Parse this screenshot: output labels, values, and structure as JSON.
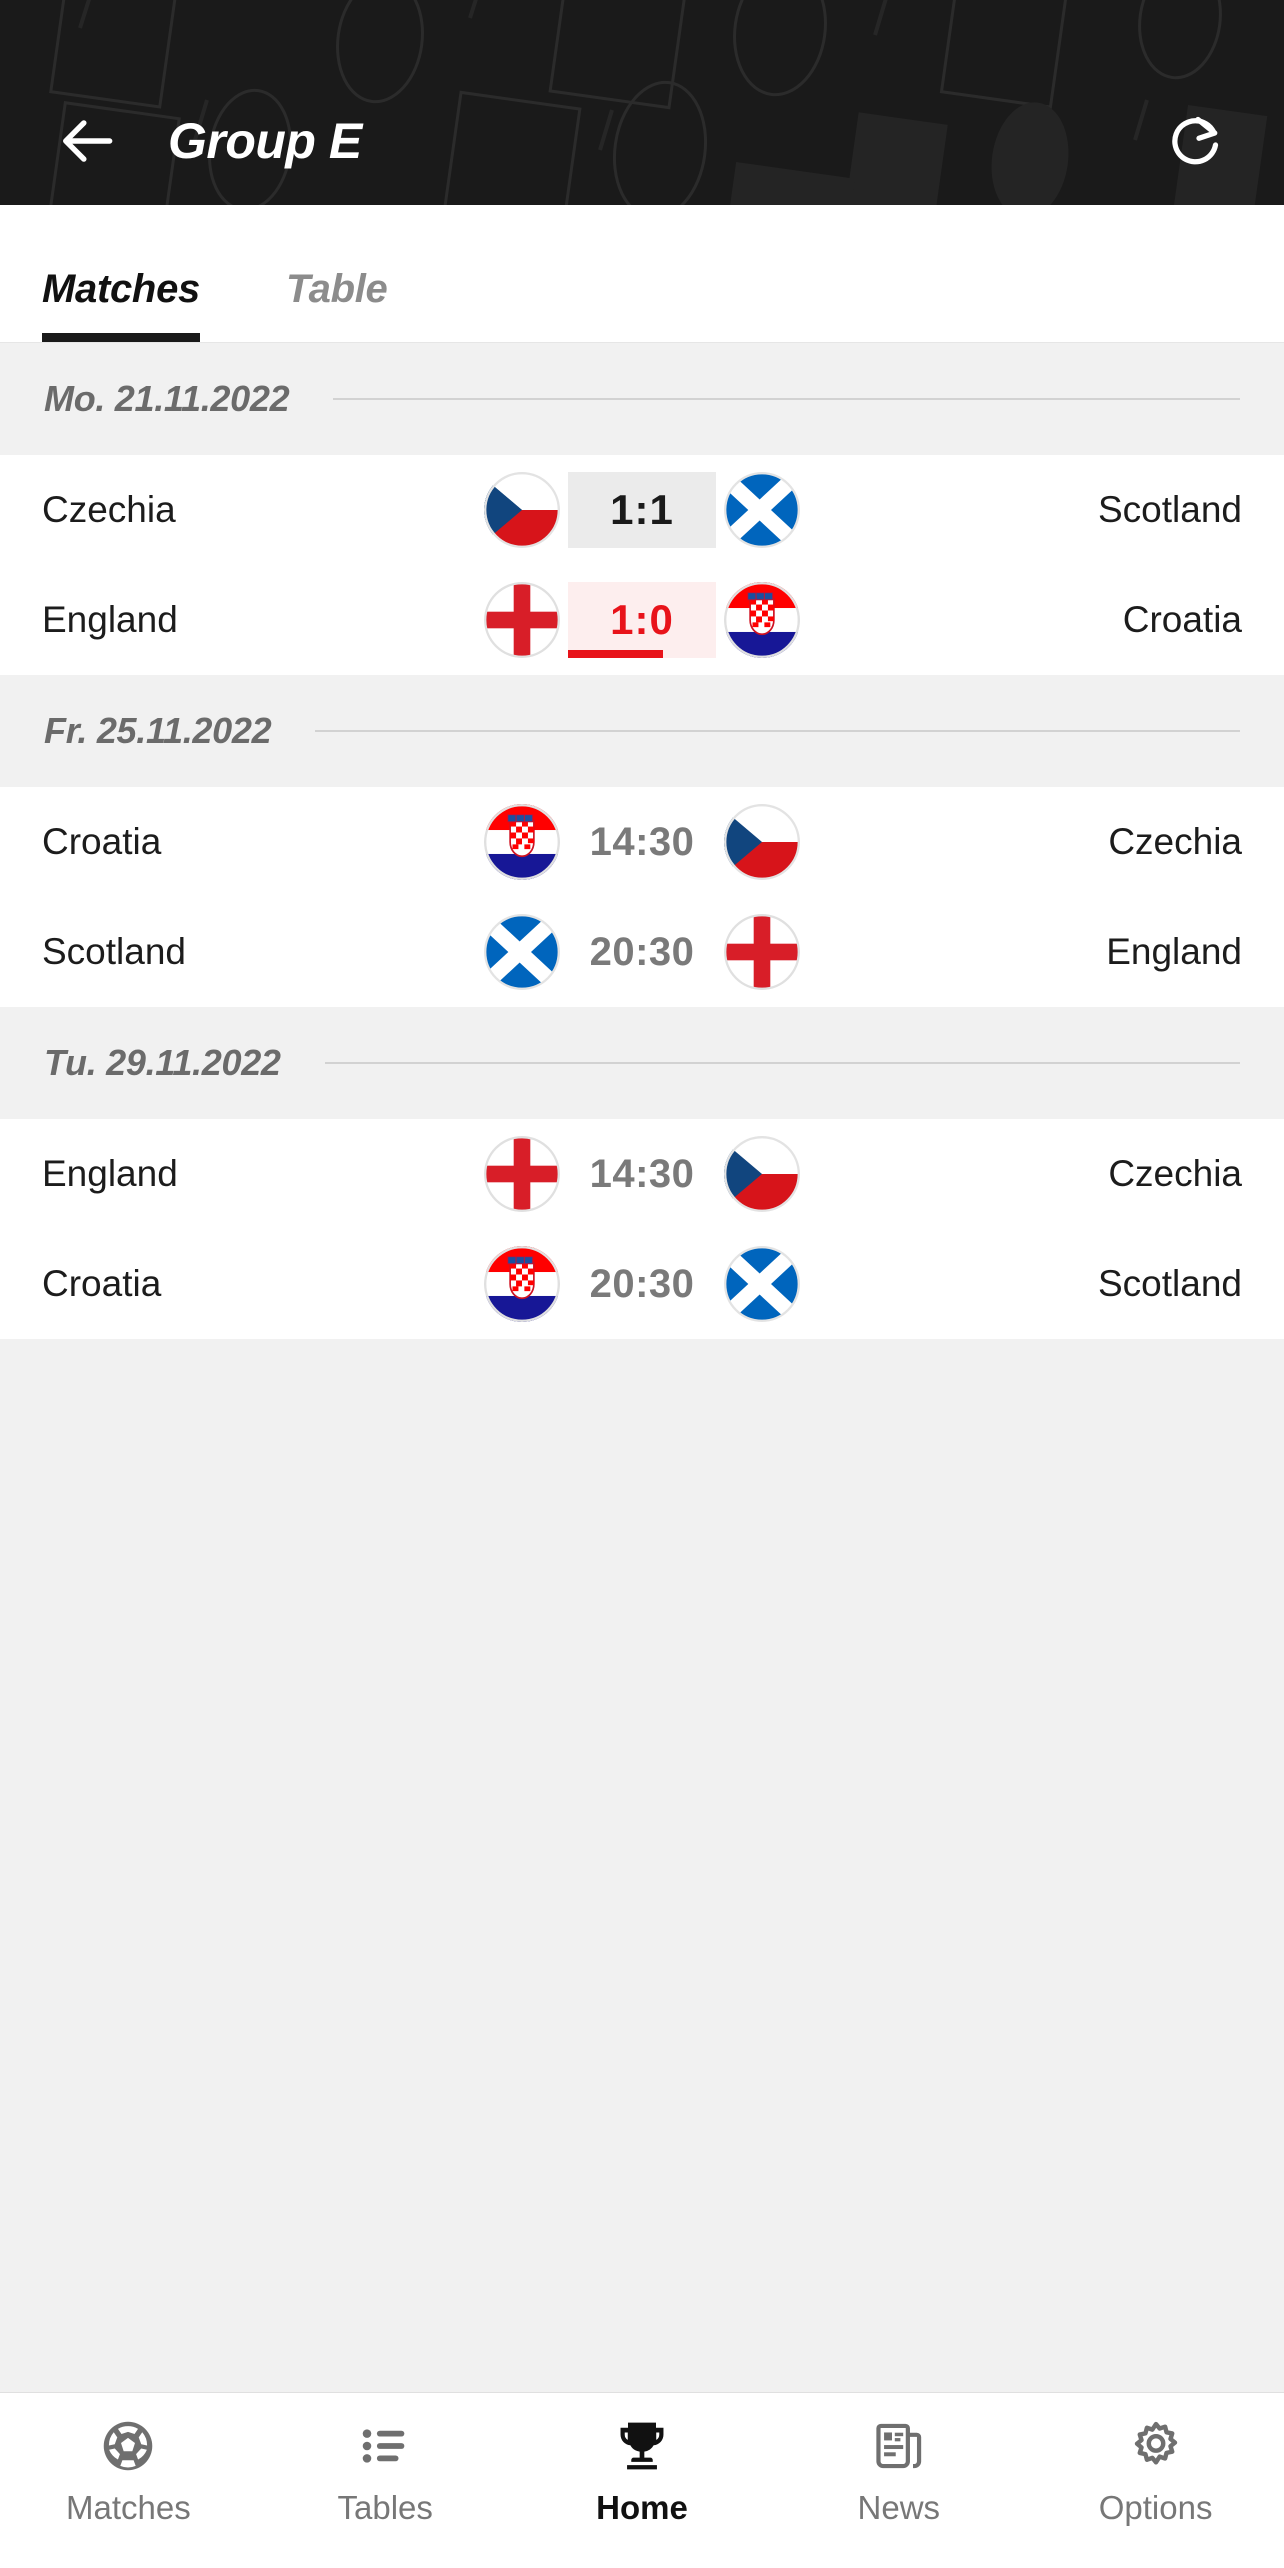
{
  "header": {
    "title": "Group E",
    "back_icon": "arrow-left-icon",
    "refresh_icon": "refresh-icon"
  },
  "tabs": [
    {
      "label": "Matches",
      "active": true
    },
    {
      "label": "Table",
      "active": false
    }
  ],
  "colors": {
    "header_bg": "#1a1a1a",
    "page_bg": "#f1f1f1",
    "row_bg": "#ffffff",
    "score_bg": "#ebebeb",
    "live_bg": "#fdeeee",
    "live_accent": "#e8131a",
    "muted_text": "#6b6b6b"
  },
  "sections": [
    {
      "date": "Mo. 21.11.2022",
      "matches": [
        {
          "home": "Czechia",
          "away": "Scotland",
          "home_flag": "flag-czechia",
          "away_flag": "flag-scotland",
          "status": "finished",
          "score": "1:1"
        },
        {
          "home": "England",
          "away": "Croatia",
          "home_flag": "flag-england",
          "away_flag": "flag-croatia",
          "status": "live",
          "score": "1:0"
        }
      ]
    },
    {
      "date": "Fr. 25.11.2022",
      "matches": [
        {
          "home": "Croatia",
          "away": "Czechia",
          "home_flag": "flag-croatia",
          "away_flag": "flag-czechia",
          "status": "scheduled",
          "score": "14:30"
        },
        {
          "home": "Scotland",
          "away": "England",
          "home_flag": "flag-scotland",
          "away_flag": "flag-england",
          "status": "scheduled",
          "score": "20:30"
        }
      ]
    },
    {
      "date": "Tu. 29.11.2022",
      "matches": [
        {
          "home": "England",
          "away": "Czechia",
          "home_flag": "flag-england",
          "away_flag": "flag-czechia",
          "status": "scheduled",
          "score": "14:30"
        },
        {
          "home": "Croatia",
          "away": "Scotland",
          "home_flag": "flag-croatia",
          "away_flag": "flag-scotland",
          "status": "scheduled",
          "score": "20:30"
        }
      ]
    }
  ],
  "bottom_nav": [
    {
      "label": "Matches",
      "icon": "soccer-ball-icon",
      "active": false
    },
    {
      "label": "Tables",
      "icon": "list-icon",
      "active": false
    },
    {
      "label": "Home",
      "icon": "trophy-icon",
      "active": true
    },
    {
      "label": "News",
      "icon": "newspaper-icon",
      "active": false
    },
    {
      "label": "Options",
      "icon": "gear-icon",
      "active": false
    }
  ]
}
